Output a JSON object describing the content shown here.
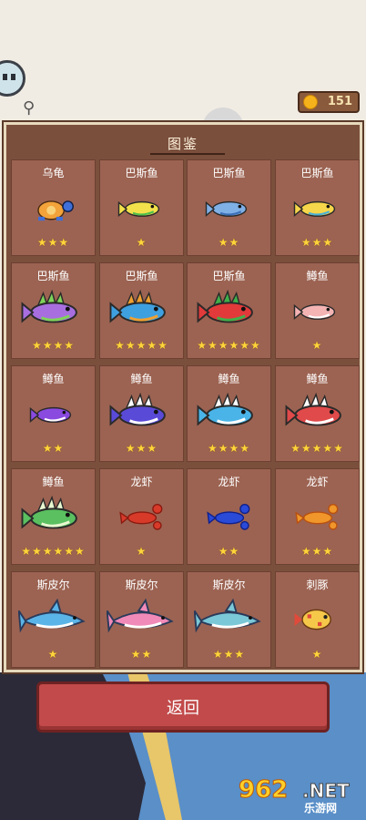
{
  "coins": {
    "value": "151"
  },
  "collection": {
    "title": "图鉴",
    "entries": [
      {
        "name": "乌龟",
        "stars": "★★★",
        "color": "#3f6fd8",
        "accent": "#f3a33a",
        "kind": "turtle"
      },
      {
        "name": "巴斯鱼",
        "stars": "★",
        "color": "#f2e14a",
        "accent": "#4cc04c",
        "kind": "fish"
      },
      {
        "name": "巴斯鱼",
        "stars": "★★",
        "color": "#7fb0e6",
        "accent": "#3b6fb8",
        "kind": "fish"
      },
      {
        "name": "巴斯鱼",
        "stars": "★★★",
        "color": "#f6d64a",
        "accent": "#4ab0d8",
        "kind": "fish"
      },
      {
        "name": "巴斯鱼",
        "stars": "★★★★",
        "color": "#a86ee0",
        "accent": "#7fd35a",
        "kind": "spiky"
      },
      {
        "name": "巴斯鱼",
        "stars": "★★★★★",
        "color": "#3fa0e0",
        "accent": "#f0a030",
        "kind": "spiky"
      },
      {
        "name": "巴斯鱼",
        "stars": "★★★★★★",
        "color": "#e23a3a",
        "accent": "#3fb04a",
        "kind": "spiky"
      },
      {
        "name": "鳟鱼",
        "stars": "★",
        "color": "#f4b4b4",
        "accent": "#ffffff",
        "kind": "fish"
      },
      {
        "name": "鳟鱼",
        "stars": "★★",
        "color": "#8a4ae0",
        "accent": "#ffffff",
        "kind": "fish"
      },
      {
        "name": "鳟鱼",
        "stars": "★★★",
        "color": "#5a4ad8",
        "accent": "#ffffff",
        "kind": "spiky"
      },
      {
        "name": "鳟鱼",
        "stars": "★★★★",
        "color": "#4ab4e8",
        "accent": "#ffffff",
        "kind": "spiky"
      },
      {
        "name": "鳟鱼",
        "stars": "★★★★★",
        "color": "#e04a4a",
        "accent": "#ffffff",
        "kind": "spiky"
      },
      {
        "name": "鳟鱼",
        "stars": "★★★★★★",
        "color": "#5ac060",
        "accent": "#e8f8d0",
        "kind": "spiky"
      },
      {
        "name": "龙虾",
        "stars": "★",
        "color": "#d83a2a",
        "accent": "#8a1a10",
        "kind": "lobster"
      },
      {
        "name": "龙虾",
        "stars": "★★",
        "color": "#2a4ad8",
        "accent": "#10208a",
        "kind": "lobster"
      },
      {
        "name": "龙虾",
        "stars": "★★★",
        "color": "#f0962a",
        "accent": "#b85010",
        "kind": "lobster"
      },
      {
        "name": "斯皮尔",
        "stars": "★",
        "color": "#5ab4e8",
        "accent": "#ffffff",
        "kind": "shark"
      },
      {
        "name": "斯皮尔",
        "stars": "★★",
        "color": "#f08ab8",
        "accent": "#ffffff",
        "kind": "shark"
      },
      {
        "name": "斯皮尔",
        "stars": "★★★",
        "color": "#7ac8d8",
        "accent": "#ffffff",
        "kind": "shark"
      },
      {
        "name": "刺豚",
        "stars": "★",
        "color": "#f6c84a",
        "accent": "#e04a3a",
        "kind": "puffer"
      }
    ]
  },
  "back_button": {
    "label": "返回"
  },
  "watermark": {
    "number": "962",
    "suffix": ".NET",
    "sub": "乐游网"
  }
}
